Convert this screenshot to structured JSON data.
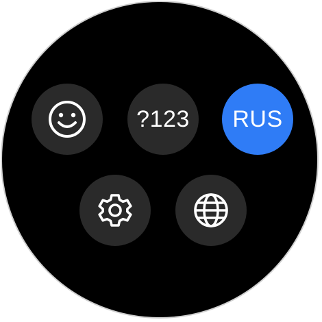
{
  "keys": {
    "emoji": {
      "icon": "smiley-icon"
    },
    "symbols": {
      "label": "?123"
    },
    "language": {
      "label": "RUS"
    },
    "settings": {
      "icon": "gear-icon"
    },
    "globe": {
      "icon": "globe-icon"
    }
  },
  "colors": {
    "background": "#000000",
    "key": "#2a2a2a",
    "accent": "#2f7cf6",
    "text": "#ffffff"
  }
}
